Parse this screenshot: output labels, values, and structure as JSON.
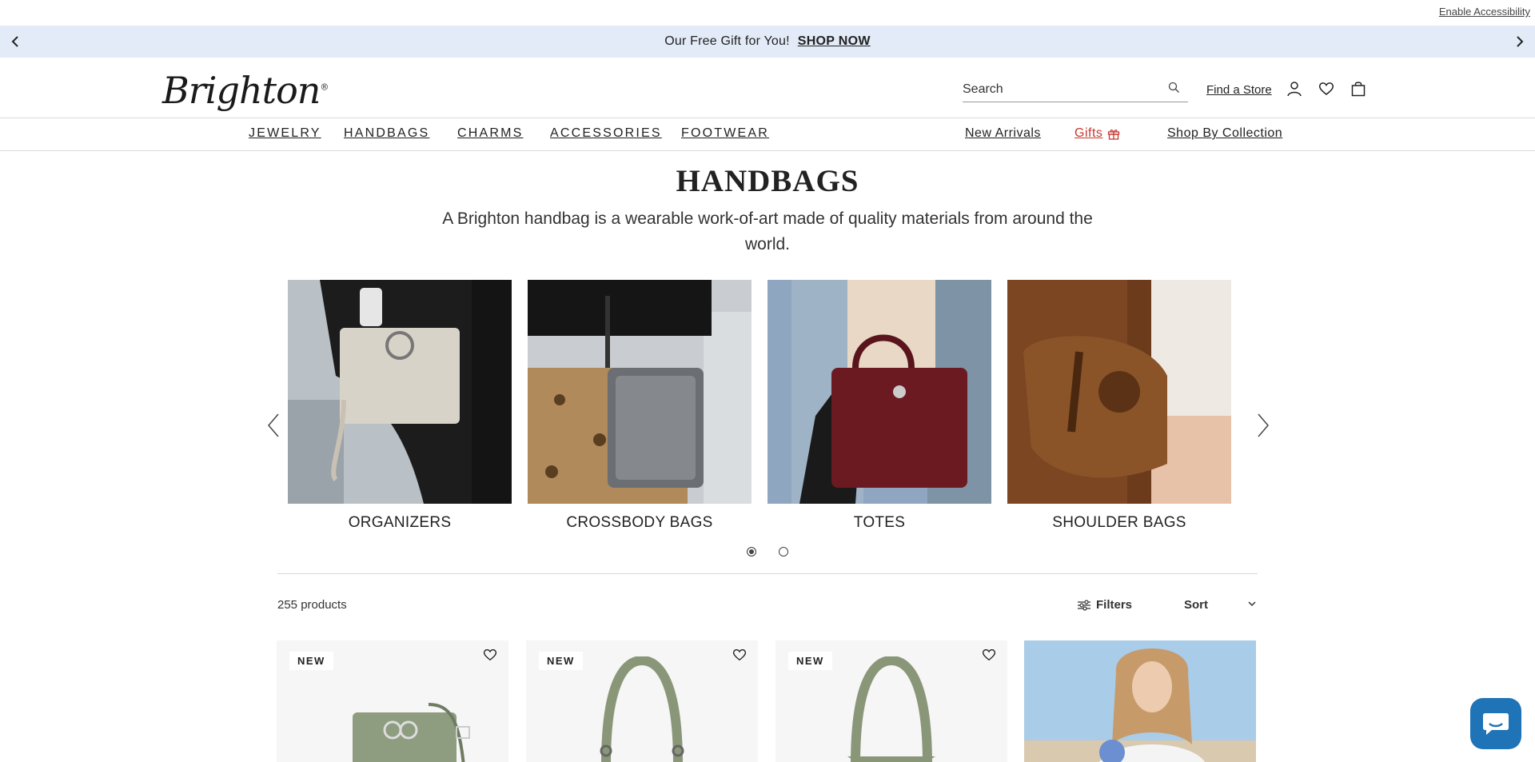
{
  "utility": {
    "accessibility_link": "Enable Accessibility"
  },
  "promo": {
    "text": "Our Free Gift for You!",
    "link": "SHOP NOW"
  },
  "header": {
    "logo": "Brighton",
    "search_placeholder": "Search",
    "find_store": "Find a Store"
  },
  "nav": {
    "categories": [
      "JEWELRY",
      "HANDBAGS",
      "CHARMS",
      "ACCESSORIES",
      "FOOTWEAR"
    ],
    "new_arrivals": "New Arrivals",
    "gifts": "Gifts",
    "shop_by_collection": "Shop By Collection"
  },
  "page": {
    "title": "HANDBAGS",
    "description": "A Brighton handbag is a wearable work-of-art made of quality materials from around the world."
  },
  "carousel": {
    "tiles": [
      {
        "label": "ORGANIZERS"
      },
      {
        "label": "CROSSBODY BAGS"
      },
      {
        "label": "TOTES"
      },
      {
        "label": "SHOULDER BAGS"
      }
    ],
    "page_count": 2,
    "active_page": 1
  },
  "listing": {
    "count": "255 products",
    "filters_label": "Filters",
    "sort_label": "Sort"
  },
  "products": [
    {
      "badge": "NEW"
    },
    {
      "badge": "NEW"
    },
    {
      "badge": "NEW"
    }
  ],
  "colors": {
    "promo_bg": "#e2ebf7",
    "gifts_red": "#c43a31",
    "chat_blue": "#1f73b7"
  }
}
